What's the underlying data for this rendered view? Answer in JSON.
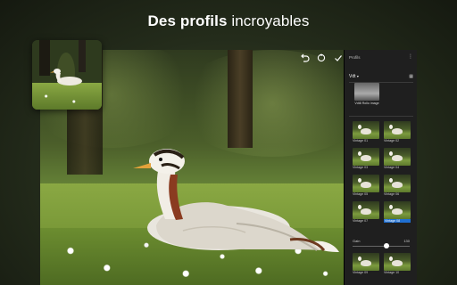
{
  "headline": {
    "bold": "Des profils",
    "light": "incroyables"
  },
  "panel": {
    "title": "Profils",
    "more_icon": "more-vertical-icon",
    "group": "Vdt",
    "group_icon": "chevron-down-icon",
    "grid_icon": "grid-icon",
    "featured_label": "Vdt8 Rollo image",
    "profiles": [
      {
        "label": "Vintage 01"
      },
      {
        "label": "Vintage 02"
      },
      {
        "label": "Vintage 03"
      },
      {
        "label": "Vintage 04"
      },
      {
        "label": "Vintage 05"
      },
      {
        "label": "Vintage 06"
      },
      {
        "label": "Vintage 07"
      },
      {
        "label": "Vintage 08"
      },
      {
        "label": "Vintage 09"
      },
      {
        "label": "Vintage 10"
      }
    ],
    "selected_index": 7,
    "amount_label": "Gain",
    "amount_value": "130"
  },
  "toolbar": {
    "undo_icon": "undo-icon",
    "reset_icon": "reset-icon",
    "confirm_icon": "check-icon"
  },
  "colors": {
    "selected": "#1f6fd2",
    "panel_bg": "#1f1f1f"
  }
}
